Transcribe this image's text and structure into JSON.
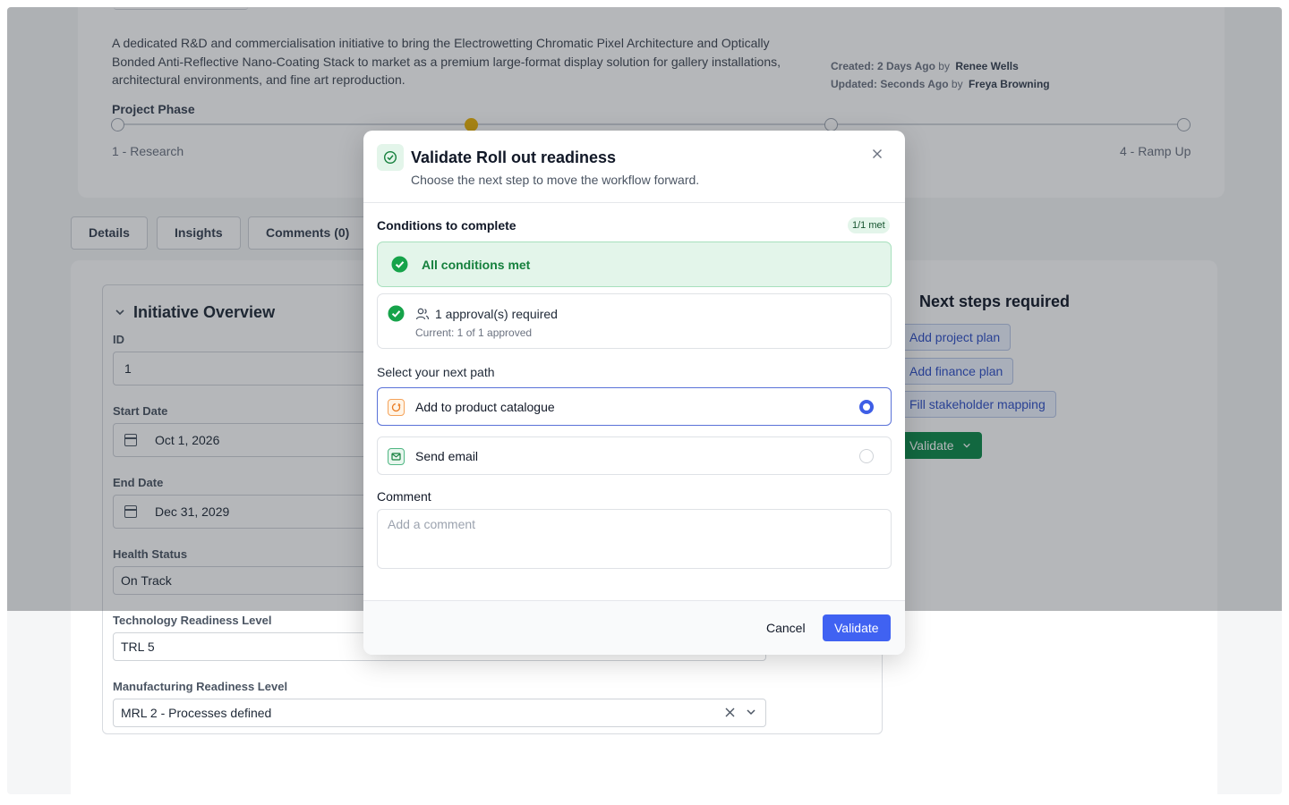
{
  "project": {
    "description": "A dedicated R&D and commercialisation initiative to bring the Electrowetting Chromatic Pixel Architecture and Optically Bonded Anti-Reflective Nano-Coating Stack to market as a premium large-format display solution for gallery installations, architectural environments, and fine art reproduction.",
    "created_label": "Created: 2 Days Ago",
    "created_by": "by",
    "created_user": "Renee Wells",
    "updated_label": "Updated: Seconds Ago",
    "updated_by": "by",
    "updated_user": "Freya Browning",
    "phase_label": "Project Phase",
    "phase_first": "1 - Research",
    "phase_last": "4 - Ramp Up",
    "phase_current_index": 2
  },
  "tabs": [
    {
      "label": "Details"
    },
    {
      "label": "Insights"
    },
    {
      "label": "Comments (0)"
    }
  ],
  "overview": {
    "title": "Initiative Overview",
    "fields": {
      "id_label": "ID",
      "id_value": "1",
      "start_label": "Start Date",
      "start_value": "Oct 1, 2026",
      "end_label": "End Date",
      "end_value": "Dec 31, 2029",
      "health_label": "Health Status",
      "health_value": "On Track",
      "trl_label": "Technology Readiness Level",
      "trl_value": "TRL 5",
      "mrl_label": "Manufacturing Readiness Level",
      "mrl_value": "MRL 2 - Processes defined"
    }
  },
  "next_steps": {
    "title": "Next steps required",
    "items": [
      "Add project plan",
      "Add finance plan",
      "Fill stakeholder mapping"
    ],
    "validate_label": "Validate"
  },
  "modal": {
    "title": "Validate Roll out readiness",
    "subtitle": "Choose the next step to move the workflow forward.",
    "conditions_label": "Conditions to complete",
    "met_badge": "1/1 met",
    "all_met": "All conditions met",
    "approval_text": "1 approval(s) required",
    "approval_sub": "Current: 1 of 1 approved",
    "path_label": "Select your next path",
    "options": [
      {
        "label": "Add to product catalogue",
        "selected": true
      },
      {
        "label": "Send email",
        "selected": false
      }
    ],
    "comment_label": "Comment",
    "comment_placeholder": "Add a comment",
    "cancel_label": "Cancel",
    "validate_label": "Validate"
  },
  "colors": {
    "accent": "#4062f2",
    "success": "#0d8a4a",
    "phase_active": "#eab308"
  }
}
